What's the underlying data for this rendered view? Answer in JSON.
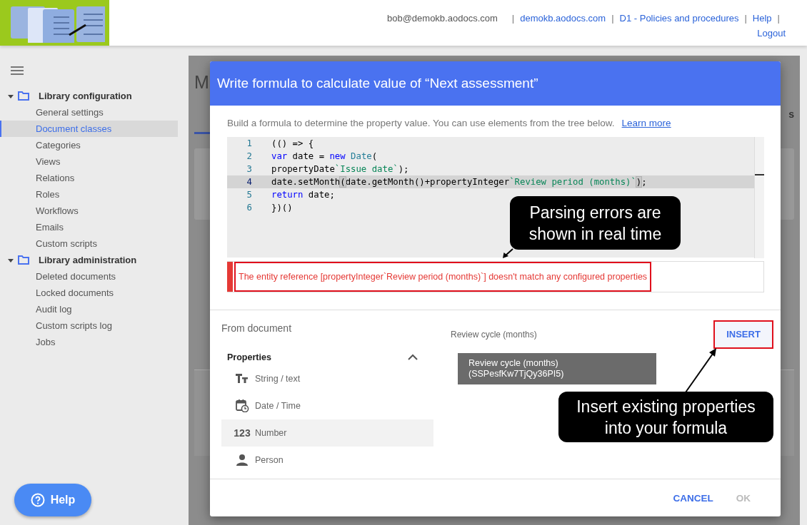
{
  "header": {
    "links": [
      {
        "text": "bob@demokb.aodocs.com",
        "kind": "user",
        "separator": "|"
      },
      {
        "text": "demokb.aodocs.com",
        "kind": "link",
        "separator": "|"
      },
      {
        "text": "D1 - Policies and procedures",
        "kind": "link",
        "separator": "|"
      },
      {
        "text": "Help",
        "kind": "link",
        "separator": "|"
      },
      {
        "text": "Logout",
        "kind": "link"
      }
    ]
  },
  "sidebar": {
    "groups": [
      {
        "title": "Library configuration",
        "expanded": true,
        "items": [
          {
            "label": "General settings",
            "selected": false
          },
          {
            "label": "Document classes",
            "selected": true
          },
          {
            "label": "Categories",
            "selected": false
          },
          {
            "label": "Views",
            "selected": false
          },
          {
            "label": "Relations",
            "selected": false
          },
          {
            "label": "Roles",
            "selected": false
          },
          {
            "label": "Workflows",
            "selected": false
          },
          {
            "label": "Emails",
            "selected": false
          },
          {
            "label": "Custom scripts",
            "selected": false
          }
        ]
      },
      {
        "title": "Library administration",
        "expanded": true,
        "items": [
          {
            "label": "Deleted documents",
            "selected": false
          },
          {
            "label": "Locked documents",
            "selected": false
          },
          {
            "label": "Audit log",
            "selected": false
          },
          {
            "label": "Custom scripts log",
            "selected": false
          },
          {
            "label": "Jobs",
            "selected": false
          }
        ]
      }
    ]
  },
  "background_page": {
    "heading": "M",
    "tab_fragment": "s"
  },
  "help_button": {
    "label": "Help"
  },
  "dialog": {
    "title": "Write formula to calculate value of “Next assessment”",
    "intro": "Build a formula to determine the property value. You can use elements from the tree below.",
    "learn_more": "Learn more",
    "code_lines": [
      {
        "number": "1",
        "highlighted": false,
        "tokens": [
          {
            "kind": "plain",
            "text": "(() => {"
          }
        ]
      },
      {
        "number": "2",
        "highlighted": false,
        "tokens": [
          {
            "kind": "keyword",
            "text": "var"
          },
          {
            "kind": "plain",
            "text": " date = "
          },
          {
            "kind": "keyword",
            "text": "new"
          },
          {
            "kind": "type",
            "text": " Date"
          },
          {
            "kind": "plain",
            "text": "("
          }
        ]
      },
      {
        "number": "3",
        "highlighted": false,
        "tokens": [
          {
            "kind": "plain",
            "text": "propertyDate"
          },
          {
            "kind": "string",
            "text": "`Issue date`"
          },
          {
            "kind": "plain",
            "text": ");"
          }
        ]
      },
      {
        "number": "4",
        "highlighted": true,
        "tokens": [
          {
            "kind": "plain",
            "text": "date.setMonth"
          },
          {
            "kind": "match",
            "text": "("
          },
          {
            "kind": "plain",
            "text": "date.getMonth()+propertyInteger"
          },
          {
            "kind": "string",
            "text": "`Review period (months)`"
          },
          {
            "kind": "match",
            "text": ")"
          },
          {
            "kind": "plain",
            "text": ";"
          }
        ]
      },
      {
        "number": "5",
        "highlighted": false,
        "tokens": [
          {
            "kind": "keyword",
            "text": "return"
          },
          {
            "kind": "plain",
            "text": " date;"
          }
        ]
      },
      {
        "number": "6",
        "highlighted": false,
        "tokens": [
          {
            "kind": "plain",
            "text": "})()"
          }
        ]
      }
    ],
    "error": {
      "message": "The entity reference [propertyInteger`Review period (months)`] doesn't match any configured properties",
      "outlined": true
    },
    "source_title": "From document",
    "properties": {
      "title": "Properties",
      "expanded": true,
      "items": [
        {
          "label": "String / text",
          "kind": "text",
          "selected": false
        },
        {
          "label": "Date / Time",
          "kind": "date",
          "selected": false
        },
        {
          "label": "Number",
          "kind": "number",
          "glyph": "123",
          "selected": true
        },
        {
          "label": "Person",
          "kind": "person",
          "selected": false
        }
      ]
    },
    "field_label": "Review cycle (months)",
    "tooltip": [
      "Review cycle (months)",
      "(SSPesfKw7TjQy36PI5)"
    ],
    "insert_button": {
      "label": "INSERT",
      "outlined": true
    },
    "buttons": [
      {
        "label": "CANCEL",
        "disabled": false
      },
      {
        "label": "OK",
        "disabled": true
      }
    ],
    "callouts": [
      {
        "kind": "errors",
        "lines": [
          "Parsing errors are",
          "shown in real time"
        ]
      },
      {
        "kind": "insert",
        "lines": [
          "Insert existing properties",
          "into your formula"
        ]
      }
    ]
  }
}
